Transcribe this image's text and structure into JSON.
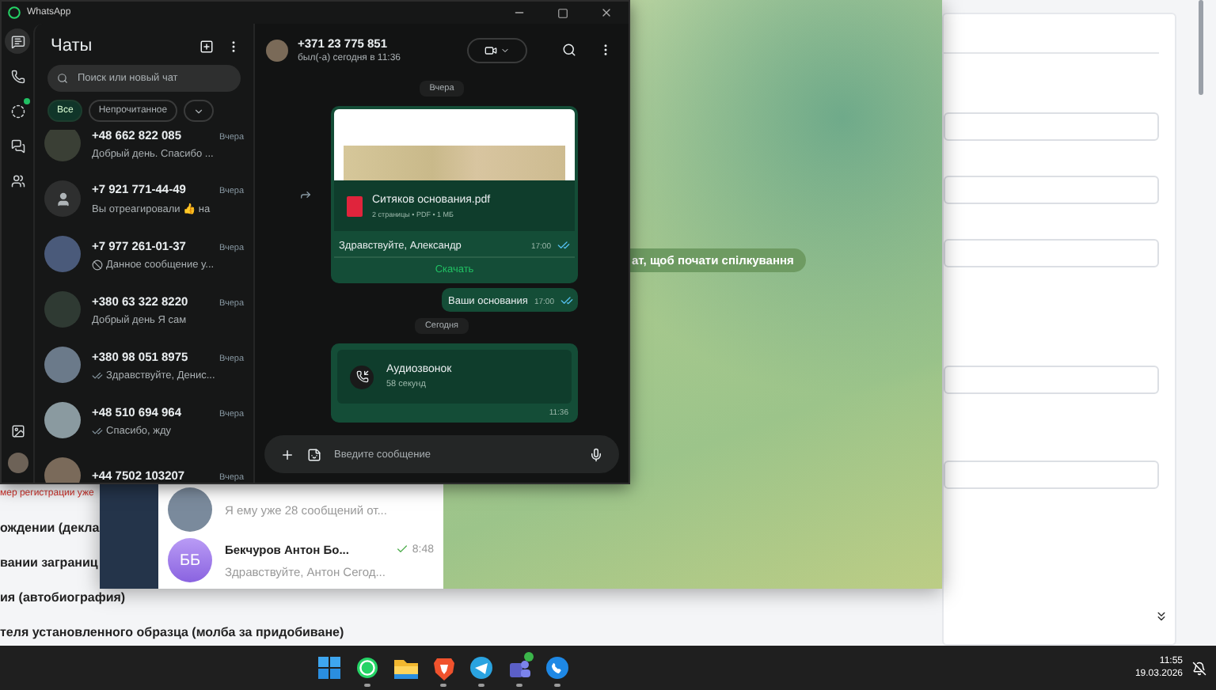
{
  "web_page": {
    "texts": [
      {
        "text": "мер регистрации уже",
        "kind": "error"
      },
      {
        "text": "ождении (декла",
        "kind": "label"
      },
      {
        "text": "вании заграниц",
        "kind": "label"
      },
      {
        "text": "ия (автобиография)",
        "kind": "label"
      },
      {
        "text": "теля установленного образца (молба за придобиване)",
        "kind": "label"
      }
    ]
  },
  "telegram": {
    "chats": [
      {
        "kind": "photo",
        "preview": "Я ему уже 28 сообщений от..."
      },
      {
        "kind": "initials",
        "initials": "ББ",
        "name": "Бекчуров Антон Бо...",
        "sent": true,
        "time": "8:48",
        "preview": "Здравствуйте, Антон Сегод..."
      }
    ],
    "hint": "ат, щоб почати спілкування"
  },
  "whatsapp": {
    "title": "WhatsApp",
    "rail": [
      {
        "selected": true,
        "unread": false
      },
      {
        "selected": false,
        "unread": false
      },
      {
        "selected": false,
        "unread": true
      },
      {
        "selected": false,
        "unread": false
      },
      {
        "selected": false,
        "unread": false
      }
    ],
    "list_title": "Чаты",
    "search": {
      "placeholder": "Поиск или новый чат"
    },
    "filters": [
      {
        "label": "Все",
        "selected": true
      },
      {
        "label": "Непрочитанное",
        "selected": false
      }
    ],
    "chats": [
      {
        "kind": "photo",
        "name": "+48 662 822 085",
        "time": "Вчера",
        "sent": false,
        "deleted": false,
        "preview": "Добрый день. Спасибо ..."
      },
      {
        "kind": "generic",
        "name": "+7 921 771-44-49",
        "time": "Вчера",
        "sent": false,
        "deleted": false,
        "preview": "Вы отреагировали 👍 на"
      },
      {
        "kind": "photo",
        "name": "+7 977 261-01-37",
        "time": "Вчера",
        "sent": false,
        "deleted": true,
        "preview": "Данное сообщение у..."
      },
      {
        "kind": "photo",
        "name": "+380 63 322 8220",
        "time": "Вчера",
        "sent": false,
        "deleted": false,
        "preview": "Добрый день  Я сам"
      },
      {
        "kind": "photo",
        "name": "+380 98 051 8975",
        "time": "Вчера",
        "sent": true,
        "deleted": false,
        "preview": "Здравствуйте, Денис..."
      },
      {
        "kind": "photo",
        "name": "+48 510 694 964",
        "time": "Вчера",
        "sent": true,
        "deleted": false,
        "preview": "Спасибо, жду"
      },
      {
        "kind": "photo",
        "name": "+44 7502 103207",
        "time": "Вчера"
      }
    ],
    "conversation": {
      "name": "+371 23 775 851",
      "status": "был(-а) сегодня в 11:36",
      "messages": [
        {
          "kind": "date",
          "text": "Вчера"
        },
        {
          "kind": "document",
          "file": "Ситяков основания.pdf",
          "meta": "2 страницы • PDF • 1 МБ",
          "caption": "Здравствуйте, Александр",
          "time": "17:00",
          "read": true,
          "action": "Скачать"
        },
        {
          "kind": "text",
          "text": "Ваши основания",
          "time": "17:00",
          "read": true
        },
        {
          "kind": "date",
          "text": "Сегодня"
        },
        {
          "kind": "call",
          "title": "Аудиозвонок",
          "duration": "58 секунд",
          "time": "11:36"
        }
      ],
      "composer": {
        "placeholder": "Введите сообщение"
      }
    }
  },
  "taskbar": {
    "apps": [
      {
        "running": false,
        "badge": false
      },
      {
        "running": true,
        "badge": false
      },
      {
        "running": false,
        "badge": false
      },
      {
        "running": true,
        "badge": false
      },
      {
        "running": true,
        "badge": false
      },
      {
        "running": true,
        "badge": true
      },
      {
        "running": true,
        "badge": false
      }
    ],
    "time": "11:55",
    "date": "19.03.2026"
  }
}
